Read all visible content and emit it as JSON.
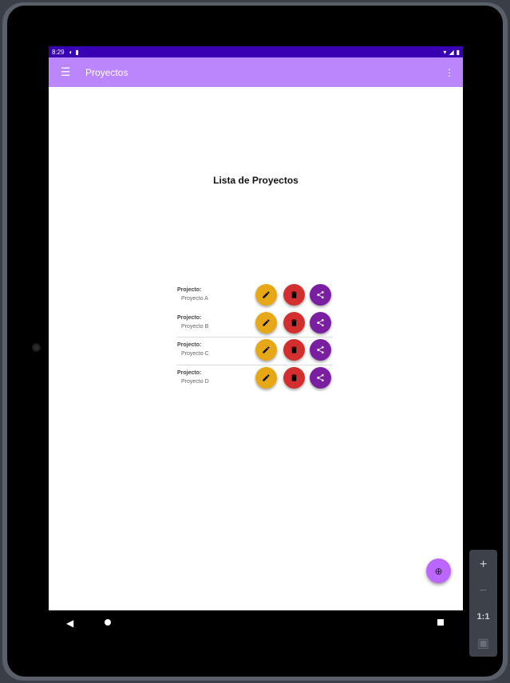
{
  "status_bar": {
    "time": "8:29"
  },
  "app_bar": {
    "title": "Proyectos",
    "menu_icon": "menu-icon",
    "overflow_icon": "more-vert-icon"
  },
  "list_title": "Lista de Proyectos",
  "projects": [
    {
      "label": "Projecto:",
      "name": "Proyecto A"
    },
    {
      "label": "Projecto:",
      "name": "Proyecto B"
    },
    {
      "label": "Projecto:",
      "name": "Proyecto C"
    },
    {
      "label": "Projecto:",
      "name": "Proyecto D"
    }
  ],
  "fab": {
    "icon": "add-circle-icon",
    "glyph": "⊕"
  },
  "emulator_controls": {
    "zoom_in": "+",
    "zoom_out": "−",
    "one_to_one": "1:1"
  },
  "colors": {
    "status_bar": "#3700b3",
    "app_bar": "#bb86fc",
    "edit_button": "#e6a817",
    "delete_button": "#d32f2f",
    "share_button": "#7b1fa2",
    "fab": "#bb66ff"
  }
}
